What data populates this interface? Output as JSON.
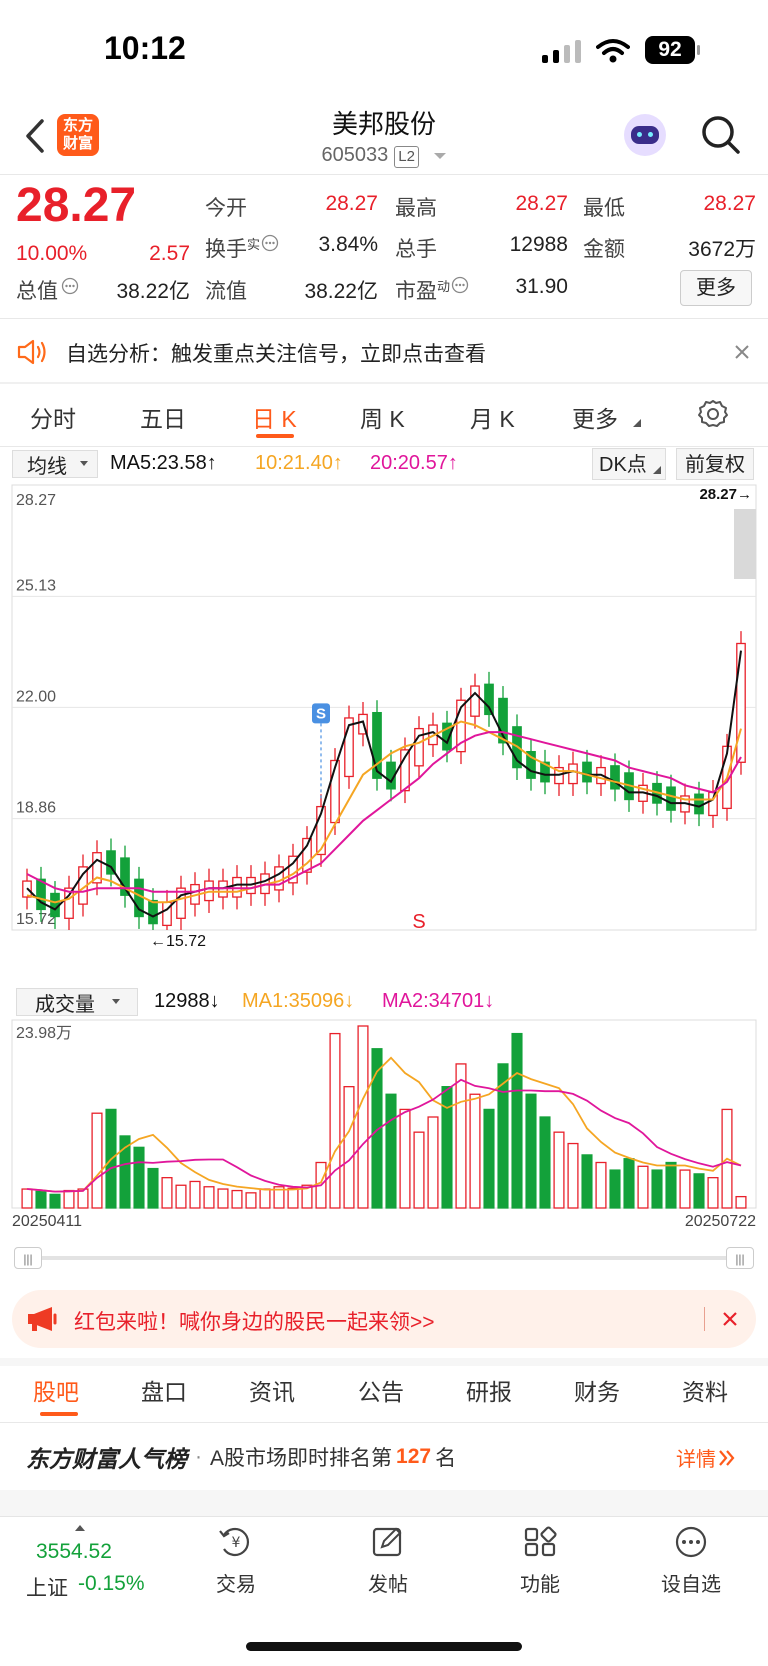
{
  "status_bar": {
    "time": "10:12",
    "battery": "92"
  },
  "header": {
    "title": "美邦股份",
    "code": "605033",
    "level": "L2",
    "logo_line1": "东方",
    "logo_line2": "财富"
  },
  "quote": {
    "price": "28.27",
    "change_pct": "10.00%",
    "change": "2.57",
    "open_label": "今开",
    "open": "28.27",
    "high_label": "最高",
    "high": "28.27",
    "low_label": "最低",
    "low": "28.27",
    "turnover_label": "换手",
    "turnover_sup": "实",
    "turnover": "3.84%",
    "volume_label": "总手",
    "volume": "12988",
    "amount_label": "金额",
    "amount": "3672万",
    "mktcap_label": "总值",
    "mktcap": "38.22亿",
    "float_label": "流值",
    "float_cap": "38.22亿",
    "pe_label": "市盈",
    "pe_sup": "动",
    "pe": "31.90",
    "more_button": "更多"
  },
  "banner": {
    "text": "自选分析：触发重点关注信号，立即点击查看"
  },
  "tabs": [
    "分时",
    "五日",
    "日 K",
    "周 K",
    "月 K",
    "更多"
  ],
  "active_tab": "日 K",
  "indicator_bar": {
    "selector": "均线",
    "ma5": "MA5:23.58↑",
    "ma10": "10:21.40↑",
    "ma20": "20:20.57↑",
    "dk": "DK点",
    "adjust": "前复权"
  },
  "volume_bar": {
    "selector": "成交量",
    "vol": "12988↓",
    "ma1": "MA1:35096↓",
    "ma2": "MA2:34701↓"
  },
  "colors": {
    "up": "#e8202a",
    "down": "#13a13a",
    "ma5": "#111111",
    "ma10": "#f5a623",
    "ma20": "#e0169b",
    "accent": "#ff6a1a"
  },
  "chart_data": [
    {
      "type": "candlestick",
      "y_ticks": [
        "28.27",
        "25.13",
        "22.00",
        "18.86",
        "15.72"
      ],
      "ylim": [
        15.72,
        28.27
      ],
      "latest_label": "28.27→",
      "low_label": "←15.72",
      "signal_buy": "S",
      "signal_sell": "S",
      "x_start": "20250411",
      "x_end": "20250722",
      "series": [
        {
          "name": "MA5",
          "values": [
            16.9,
            16.5,
            16.3,
            16.7,
            17.3,
            17.7,
            17.5,
            16.9,
            16.3,
            16.1,
            16.3,
            16.7,
            16.8,
            16.9,
            16.9,
            17.0,
            17.0,
            17.1,
            17.3,
            17.6,
            18.1,
            19.0,
            20.3,
            21.5,
            21.6,
            20.2,
            19.9,
            20.6,
            21.2,
            21.3,
            21.0,
            22.0,
            22.4,
            22.0,
            21.2,
            20.5,
            20.2,
            20.1,
            20.1,
            20.2,
            20.1,
            20.1,
            19.9,
            19.6,
            19.6,
            19.5,
            19.3,
            19.3,
            19.2,
            19.4,
            20.7,
            23.6
          ]
        },
        {
          "name": "MA10",
          "values": [
            16.7,
            16.6,
            16.5,
            16.6,
            16.9,
            17.2,
            17.1,
            16.9,
            16.7,
            16.5,
            16.5,
            16.6,
            16.7,
            16.8,
            16.8,
            16.8,
            16.9,
            17.0,
            17.1,
            17.3,
            17.6,
            18.0,
            18.7,
            19.4,
            20.1,
            20.4,
            20.7,
            20.9,
            21.0,
            21.2,
            21.4,
            21.6,
            21.5,
            21.3,
            21.1,
            20.9,
            20.6,
            20.4,
            20.2,
            20.2,
            20.1,
            20.0,
            19.9,
            19.8,
            19.7,
            19.6,
            19.5,
            19.4,
            19.4,
            19.4,
            20.0,
            21.4
          ]
        },
        {
          "name": "MA20",
          "values": [
            17.3,
            17.1,
            16.9,
            16.8,
            16.8,
            16.9,
            16.9,
            16.9,
            16.9,
            16.8,
            16.8,
            16.8,
            16.8,
            16.9,
            16.9,
            16.9,
            16.9,
            17.0,
            17.0,
            17.2,
            17.4,
            17.6,
            18.0,
            18.4,
            18.8,
            19.1,
            19.4,
            19.7,
            20.0,
            20.4,
            20.7,
            21.0,
            21.2,
            21.3,
            21.3,
            21.2,
            21.1,
            21.0,
            20.9,
            20.8,
            20.7,
            20.6,
            20.5,
            20.3,
            20.2,
            20.1,
            20.0,
            19.8,
            19.7,
            19.6,
            19.9,
            20.6
          ]
        }
      ]
    },
    {
      "type": "bar",
      "y_ticks": [
        "23.98万"
      ],
      "ymax_label": "23.98万",
      "values": [
        2.5,
        2.2,
        1.8,
        2.3,
        2.5,
        12.5,
        13.0,
        9.5,
        8.0,
        5.2,
        4.0,
        3.0,
        3.5,
        2.8,
        2.5,
        2.3,
        2.0,
        2.5,
        2.8,
        2.6,
        3.0,
        6.0,
        23.0,
        16.0,
        24.0,
        21.0,
        15.0,
        13.0,
        10.0,
        12.0,
        16.0,
        19.0,
        15.0,
        13.0,
        19.0,
        23.0,
        15.0,
        12.0,
        10.0,
        8.5,
        7.0,
        6.0,
        5.0,
        6.5,
        5.5,
        5.0,
        6.0,
        5.0,
        4.5,
        4.0,
        13.0,
        1.5
      ]
    }
  ],
  "promo": {
    "text": "红包来啦！喊你身边的股民一起来领>>"
  },
  "bottom_tabs": [
    "股吧",
    "盘口",
    "资讯",
    "公告",
    "研报",
    "财务",
    "资料"
  ],
  "active_bottom_tab": "股吧",
  "rank": {
    "brand": "东方财富人气榜",
    "dot": "·",
    "text_before": "A股市场即时排名第",
    "rank": "127",
    "text_after": "名",
    "details": "详情"
  },
  "index": {
    "value": "3554.52",
    "name": "上证",
    "change": "-0.15%"
  },
  "bottom_nav": [
    "交易",
    "发帖",
    "功能",
    "设自选"
  ]
}
